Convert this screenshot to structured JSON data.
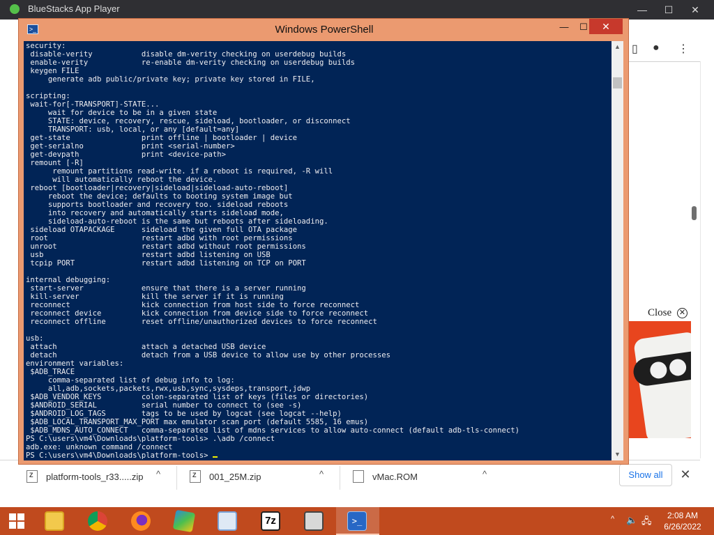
{
  "background_window": {
    "title": "BlueStacks App Player"
  },
  "powershell": {
    "title": "Windows PowerShell",
    "minimize_glyph": "—",
    "maximize_glyph": "☐",
    "close_glyph": "✕",
    "console_lines": [
      "security:",
      " disable-verity           disable dm-verity checking on userdebug builds",
      " enable-verity            re-enable dm-verity checking on userdebug builds",
      " keygen FILE",
      "     generate adb public/private key; private key stored in FILE,",
      "",
      "scripting:",
      " wait-for[-TRANSPORT]-STATE...",
      "     wait for device to be in a given state",
      "     STATE: device, recovery, rescue, sideload, bootloader, or disconnect",
      "     TRANSPORT: usb, local, or any [default=any]",
      " get-state                print offline | bootloader | device",
      " get-serialno             print <serial-number>",
      " get-devpath              print <device-path>",
      " remount [-R]",
      "      remount partitions read-write. if a reboot is required, -R will",
      "      will automatically reboot the device.",
      " reboot [bootloader|recovery|sideload|sideload-auto-reboot]",
      "     reboot the device; defaults to booting system image but",
      "     supports bootloader and recovery too. sideload reboots",
      "     into recovery and automatically starts sideload mode,",
      "     sideload-auto-reboot is the same but reboots after sideloading.",
      " sideload OTAPACKAGE      sideload the given full OTA package",
      " root                     restart adbd with root permissions",
      " unroot                   restart adbd without root permissions",
      " usb                      restart adbd listening on USB",
      " tcpip PORT               restart adbd listening on TCP on PORT",
      "",
      "internal debugging:",
      " start-server             ensure that there is a server running",
      " kill-server              kill the server if it is running",
      " reconnect                kick connection from host side to force reconnect",
      " reconnect device         kick connection from device side to force reconnect",
      " reconnect offline        reset offline/unauthorized devices to force reconnect",
      "",
      "usb:",
      " attach                   attach a detached USB device",
      " detach                   detach from a USB device to allow use by other processes",
      "environment variables:",
      " $ADB_TRACE",
      "     comma-separated list of debug info to log:",
      "     all,adb,sockets,packets,rwx,usb,sync,sysdeps,transport,jdwp",
      " $ADB_VENDOR_KEYS         colon-separated list of keys (files or directories)",
      " $ANDROID_SERIAL          serial number to connect to (see -s)",
      " $ANDROID_LOG_TAGS        tags to be used by logcat (see logcat --help)",
      " $ADB_LOCAL_TRANSPORT_MAX_PORT max emulator scan port (default 5585, 16 emus)",
      " $ADB_MDNS_AUTO_CONNECT   comma-separated list of mdns services to allow auto-connect (default adb-tls-connect)",
      "PS C:\\users\\vm4\\Downloads\\platform-tools> .\\adb /connect",
      "adb.exe: unknown command /connect"
    ],
    "prompt": "PS C:\\users\\vm4\\Downloads\\platform-tools> "
  },
  "ad": {
    "close_label": "Close",
    "close_glyph": "✕"
  },
  "downloads": {
    "items": [
      {
        "name": "platform-tools_r33.....zip",
        "icon": "zip-file-icon"
      },
      {
        "name": "001_25M.zip",
        "icon": "zip-file-icon"
      },
      {
        "name": "vMac.ROM",
        "icon": "file-icon"
      }
    ],
    "chevron_glyph": "^",
    "show_all_label": "Show all",
    "close_glyph": "✕"
  },
  "taskbar": {
    "time": "2:08 AM",
    "date": "6/26/2022",
    "apps": [
      "file-explorer-icon",
      "chrome-icon",
      "firefox-icon",
      "bluestacks-icon",
      "control-panel-icon",
      "7zip-icon",
      "vmac-icon",
      "powershell-icon"
    ],
    "seven_zip_label": "7z",
    "colors": {
      "taskbar": "#c04a1e",
      "console": "#012456",
      "titlebar": "#eb9a70"
    }
  }
}
